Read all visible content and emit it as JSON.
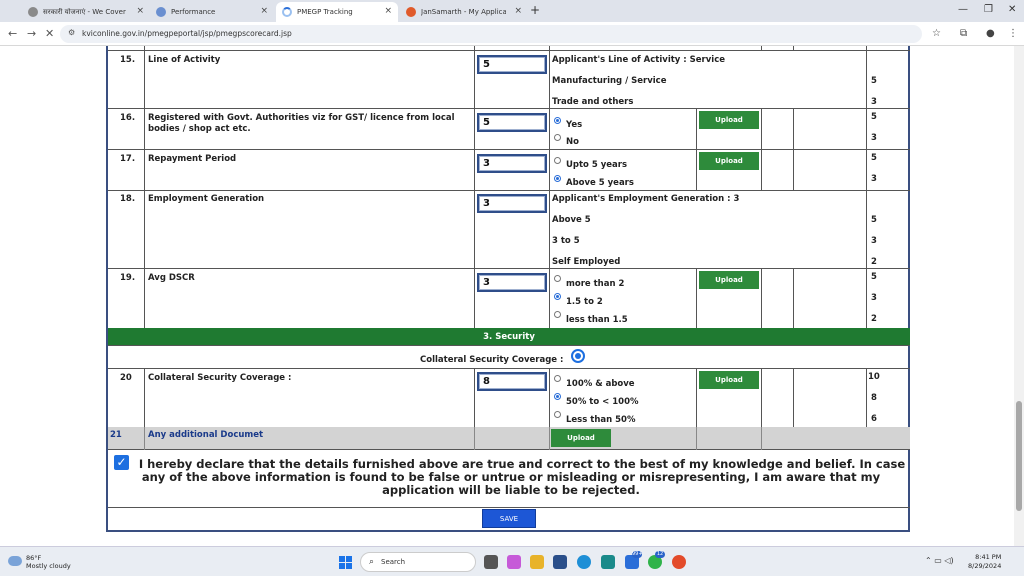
{
  "browser": {
    "tabs": [
      {
        "label": "सरकारी योजनाएं - We Cover All",
        "favicon_color": "#8a8a8a",
        "active": false
      },
      {
        "label": "Performance",
        "favicon_color": "#6a8fd0",
        "active": false
      },
      {
        "label": "PMEGP Tracking",
        "favicon_color": "#9ac0f0",
        "active": true
      },
      {
        "label": "JanSamarth - My Applications",
        "favicon_color": "#e05a2a",
        "active": false
      }
    ],
    "new_tab": "+",
    "close_glyph": "×",
    "url": "kviconline.gov.in/pmegpeportal/jsp/pmegpscorecard.jsp"
  },
  "form": {
    "rows": [
      {
        "num": "15.",
        "label": "Line of Activity",
        "value": "5",
        "header_option": "Applicant's Line of Activity : Service",
        "options": [
          {
            "label": "Manufacturing / Service",
            "score": "5"
          },
          {
            "label": "Trade and others",
            "score": "3"
          }
        ]
      },
      {
        "num": "16.",
        "label": "Registered with Govt. Authorities viz for GST/ licence from local bodies / shop act etc.",
        "value": "5",
        "upload": "Upload",
        "options": [
          {
            "label": "Yes",
            "score": "5",
            "selected": true
          },
          {
            "label": "No",
            "score": "3",
            "selected": false
          }
        ]
      },
      {
        "num": "17.",
        "label": "Repayment Period",
        "value": "3",
        "upload": "Upload",
        "options": [
          {
            "label": "Upto 5 years",
            "score": "5",
            "selected": false
          },
          {
            "label": "Above 5 years",
            "score": "3",
            "selected": true
          }
        ]
      },
      {
        "num": "18.",
        "label": "Employment Generation",
        "value": "3",
        "header_option": "Applicant's Employment Generation : 3",
        "options": [
          {
            "label": "Above 5",
            "score": "5"
          },
          {
            "label": "3 to 5",
            "score": "3"
          },
          {
            "label": "Self Employed",
            "score": "2"
          }
        ]
      },
      {
        "num": "19.",
        "label": "Avg DSCR",
        "value": "3",
        "upload": "Upload",
        "options": [
          {
            "label": "more than 2",
            "score": "5",
            "selected": false
          },
          {
            "label": "1.5 to 2",
            "score": "3",
            "selected": true
          },
          {
            "label": "less than 1.5",
            "score": "2",
            "selected": false
          }
        ]
      }
    ],
    "section_header": "3. Security",
    "collateral_label": "Collateral Security Coverage :",
    "row20": {
      "num": "20",
      "label": "Collateral Security Coverage :",
      "value": "8",
      "upload": "Upload",
      "options": [
        {
          "label": "100% & above",
          "score": "10",
          "selected": false
        },
        {
          "label": "50% to < 100%",
          "score": "8",
          "selected": true
        },
        {
          "label": "Less than 50%",
          "score": "6",
          "selected": false
        }
      ]
    },
    "row21": {
      "num": "21",
      "label": "Any additional Documet",
      "upload": "Upload"
    },
    "declaration": "I hereby declare that the details furnished above are true and correct to the best of my knowledge and belief. In case any of the above information is found to be false or untrue or misleading or misrepresenting, I am aware that my application will be liable to be rejected.",
    "save_label": "SAVE"
  },
  "taskbar": {
    "weather_temp": "86°F",
    "weather_desc": "Mostly cloudy",
    "search_placeholder": "Search",
    "time": "8:41 PM",
    "date": "8/29/2024",
    "badge_1": "99+",
    "badge_2": "12"
  }
}
